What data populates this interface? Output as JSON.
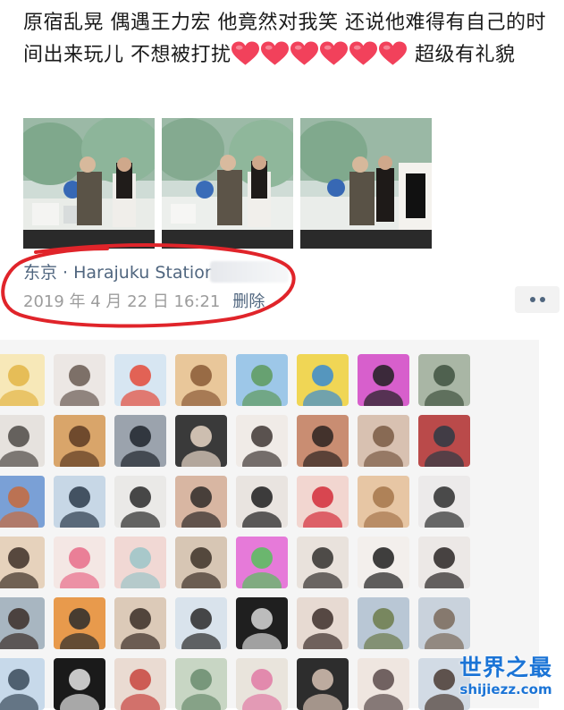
{
  "post": {
    "text": "原宿乱晃 偶遇王力宏  他竟然对我笑  还说他难得有自己的时间出来玩儿  不想被打扰",
    "trailing_text": " 超级有礼貌",
    "heart_count": 6,
    "heart_icon": "red-heart-emoji",
    "heart_color": "#f2415b"
  },
  "photos": [
    {
      "name": "street-photo-1"
    },
    {
      "name": "street-photo-2"
    },
    {
      "name": "street-photo-3"
    }
  ],
  "meta": {
    "location": "东京 · Harajuku Station",
    "timestamp": "2019 年 4 月 22 日  16:21",
    "delete_label": "删除",
    "link_color": "#50667f"
  },
  "annotation": {
    "color": "#e0242a",
    "shape": "hand-drawn-ellipse"
  },
  "likes": {
    "rows": 6,
    "columns": 8,
    "icon": "liker-avatar"
  },
  "watermark": {
    "title": "世界之最",
    "url": "shijiezz.com",
    "color": "#1b74d6"
  }
}
